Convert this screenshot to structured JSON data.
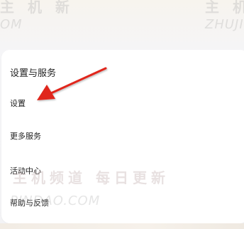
{
  "watermark": {
    "top_left_cn": "主 机 新",
    "top_left_en": "OM",
    "top_right_cn": "主 机",
    "top_right_en": "ZHUJI",
    "middle_cn": "主机频道 每日更新",
    "middle_en": "PINDAO.COM"
  },
  "section": {
    "title": "设置与服务",
    "items": [
      {
        "label": "设置"
      },
      {
        "label": "更多服务"
      },
      {
        "label": "活动中心"
      },
      {
        "label": "帮助与反馈"
      }
    ]
  },
  "annotation": {
    "arrow_color": "#e0261c",
    "icon": "red-arrow-icon"
  }
}
